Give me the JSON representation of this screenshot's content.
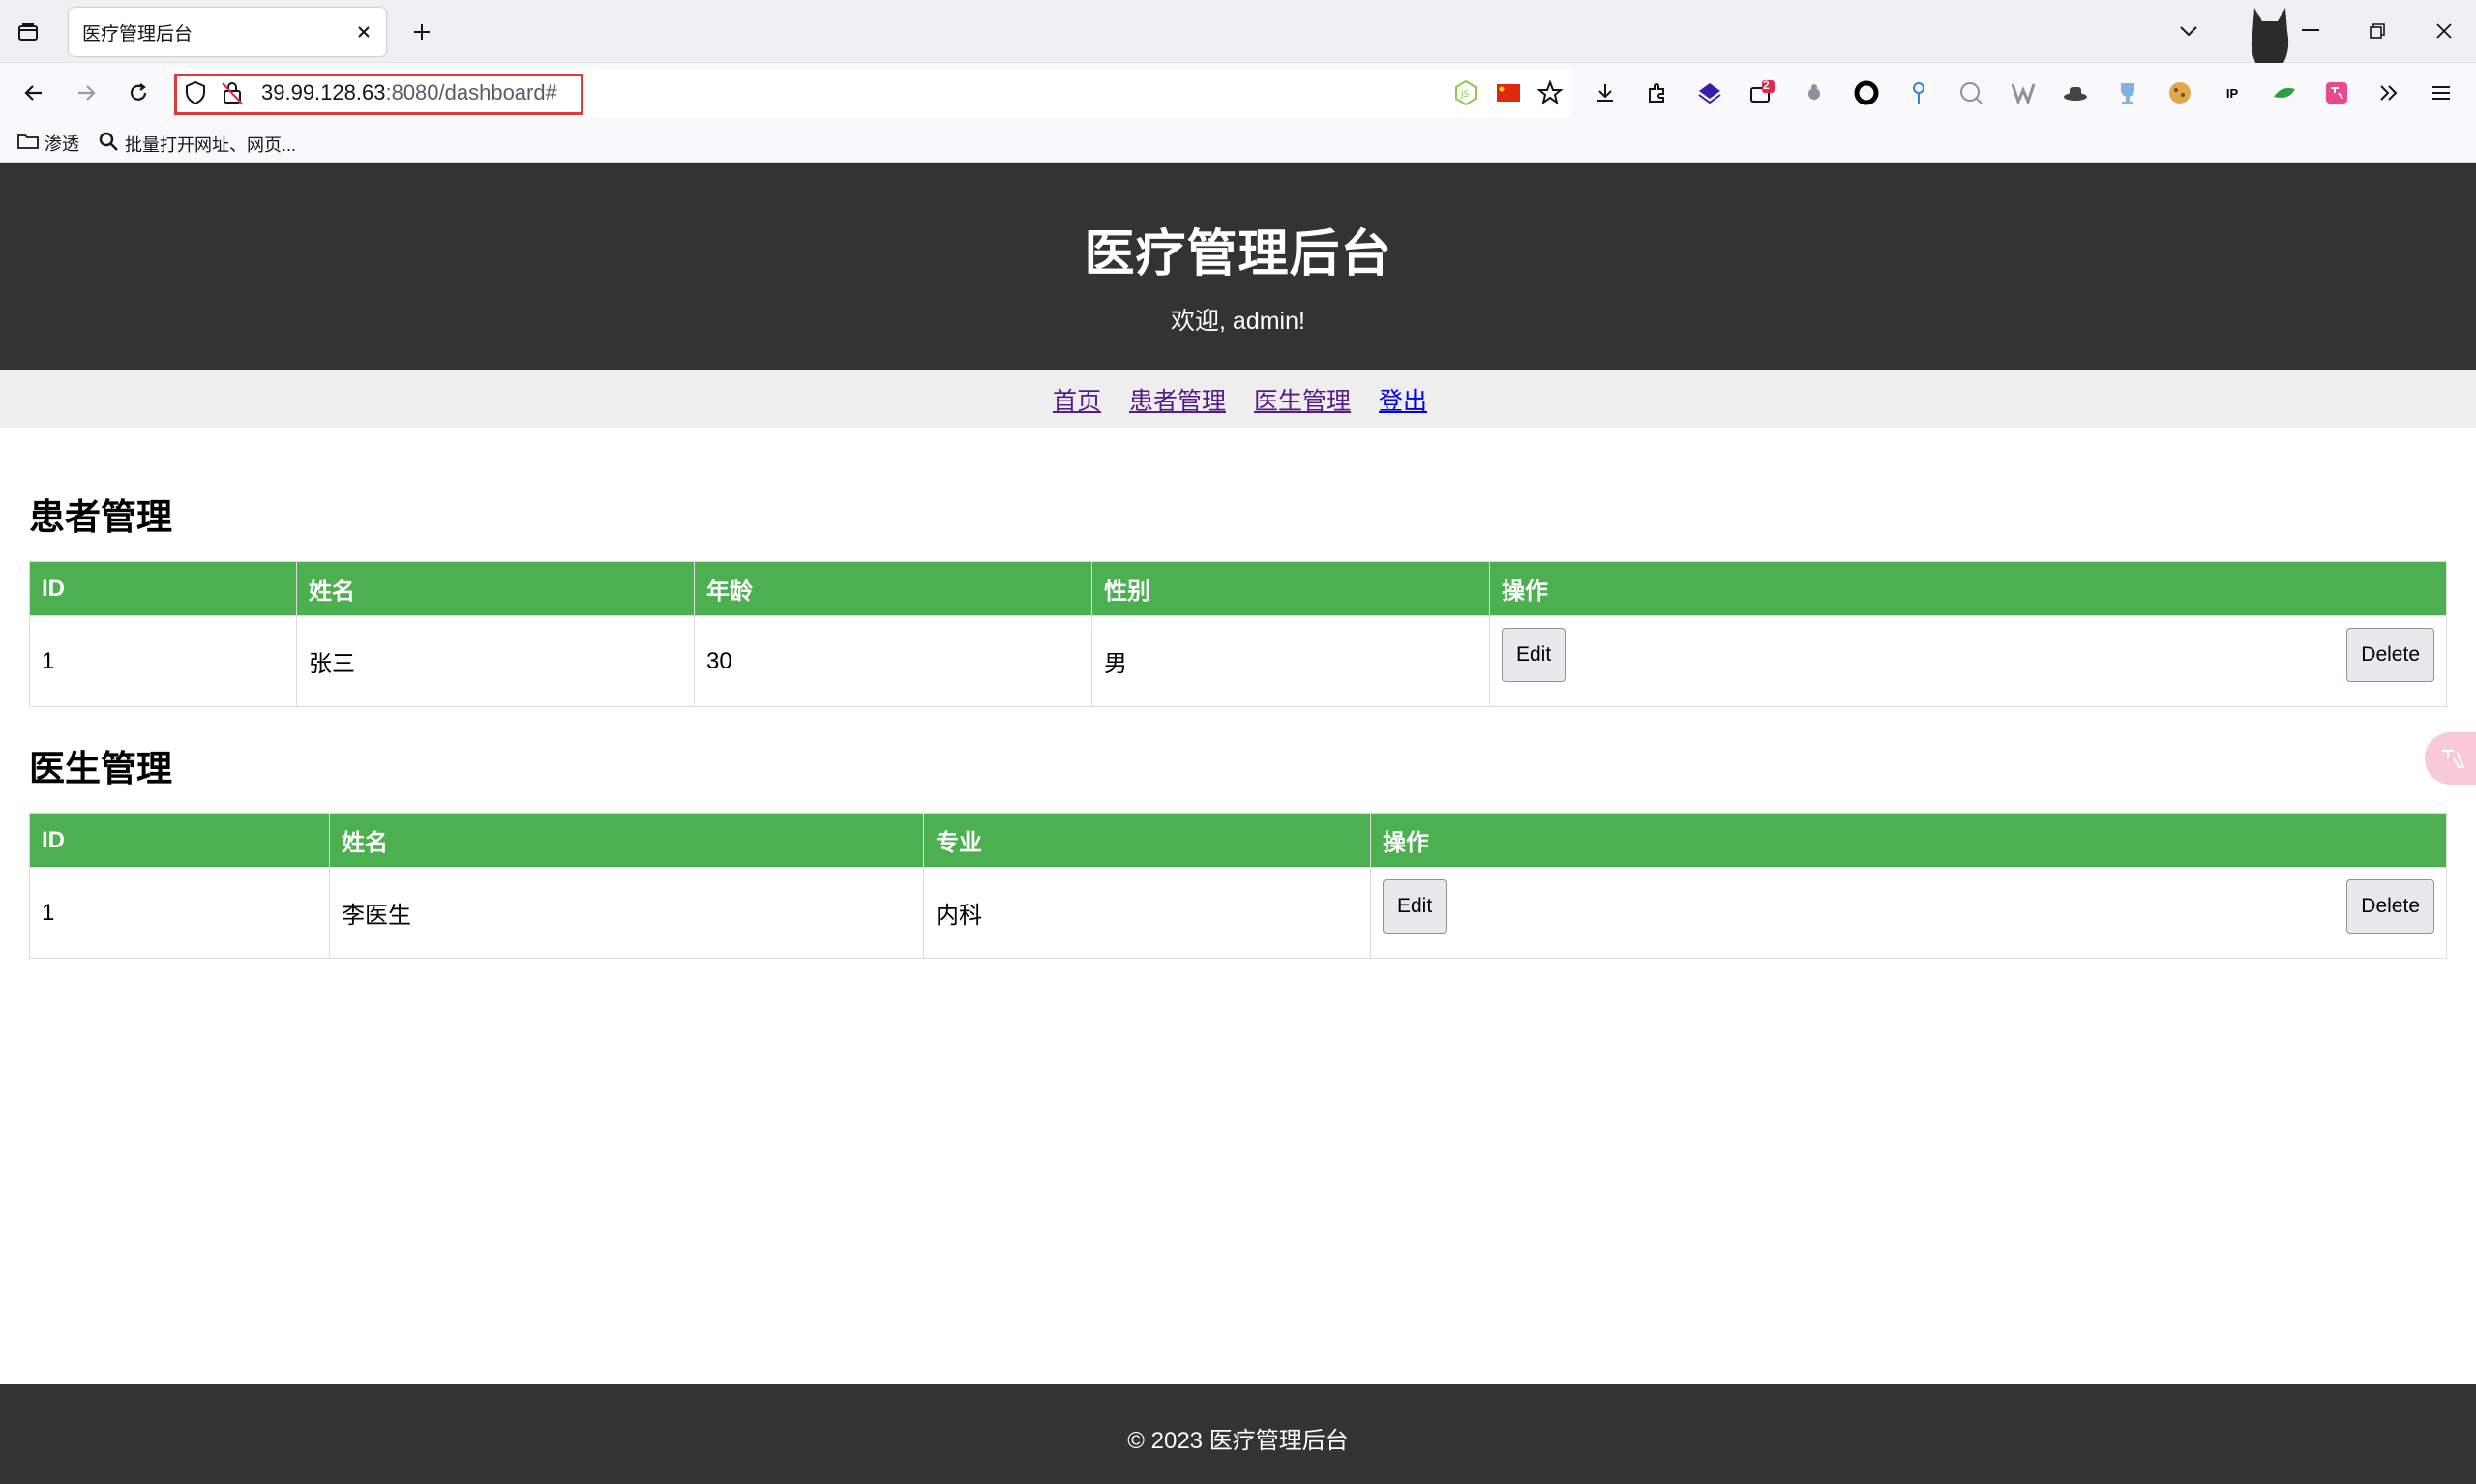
{
  "browser": {
    "tab": {
      "title": "医疗管理后台",
      "close_symbol": "✕"
    },
    "new_tab_symbol": "+",
    "url": {
      "host": "39.99.128.63",
      "rest": ":8080/dashboard#"
    },
    "bookmarks": [
      {
        "label": "渗透",
        "icon": "folder-icon"
      },
      {
        "label": "批量打开网址、网页...",
        "icon": "search-icon"
      }
    ],
    "extension_badge": "2",
    "ext_ip_label": "IP"
  },
  "header": {
    "title": "医疗管理后台",
    "welcome": "欢迎, admin!"
  },
  "nav": {
    "links": [
      "首页",
      "患者管理",
      "医生管理",
      "登出"
    ]
  },
  "patients": {
    "title": "患者管理",
    "columns": [
      "ID",
      "姓名",
      "年龄",
      "性别",
      "操作"
    ],
    "rows": [
      {
        "id": "1",
        "name": "张三",
        "age": "30",
        "gender": "男"
      }
    ],
    "edit_label": "Edit",
    "delete_label": "Delete"
  },
  "doctors": {
    "title": "医生管理",
    "columns": [
      "ID",
      "姓名",
      "专业",
      "操作"
    ],
    "rows": [
      {
        "id": "1",
        "name": "李医生",
        "specialty": "内科"
      }
    ],
    "edit_label": "Edit",
    "delete_label": "Delete"
  },
  "footer": {
    "text": "© 2023 医疗管理后台"
  },
  "colors": {
    "header_bg": "#333333",
    "table_header_bg": "#4caf50",
    "nav_bg": "#eeeeee",
    "url_highlight": "#e53935"
  }
}
